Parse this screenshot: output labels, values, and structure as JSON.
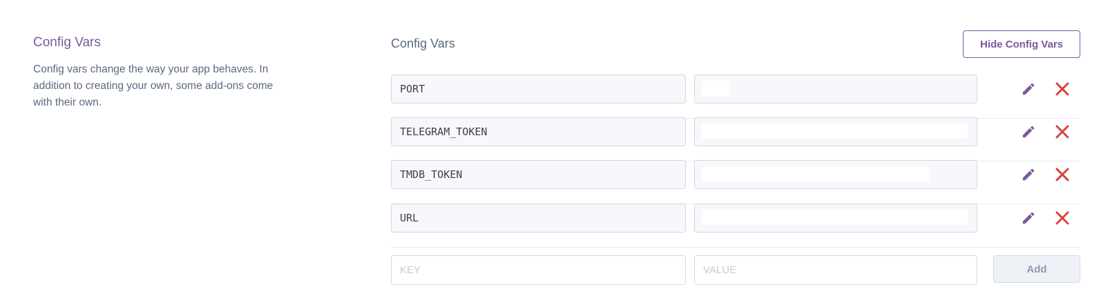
{
  "section": {
    "title": "Config Vars",
    "description": "Config vars change the way your app behaves. In addition to creating your own, some add-ons come with their own."
  },
  "panel": {
    "title": "Config Vars",
    "hide_button_label": "Hide Config Vars"
  },
  "vars": [
    {
      "key": "PORT",
      "value": ""
    },
    {
      "key": "TELEGRAM_TOKEN",
      "value": ""
    },
    {
      "key": "TMDB_TOKEN",
      "value": ""
    },
    {
      "key": "URL",
      "value": ""
    }
  ],
  "add_form": {
    "key_placeholder": "KEY",
    "value_placeholder": "VALUE",
    "add_label": "Add"
  },
  "icons": {
    "edit": "pencil-icon",
    "delete": "x-icon"
  },
  "colors": {
    "accent": "#79589f",
    "delete": "#d64141",
    "text_muted": "#596981",
    "border": "#cfd7e6"
  }
}
